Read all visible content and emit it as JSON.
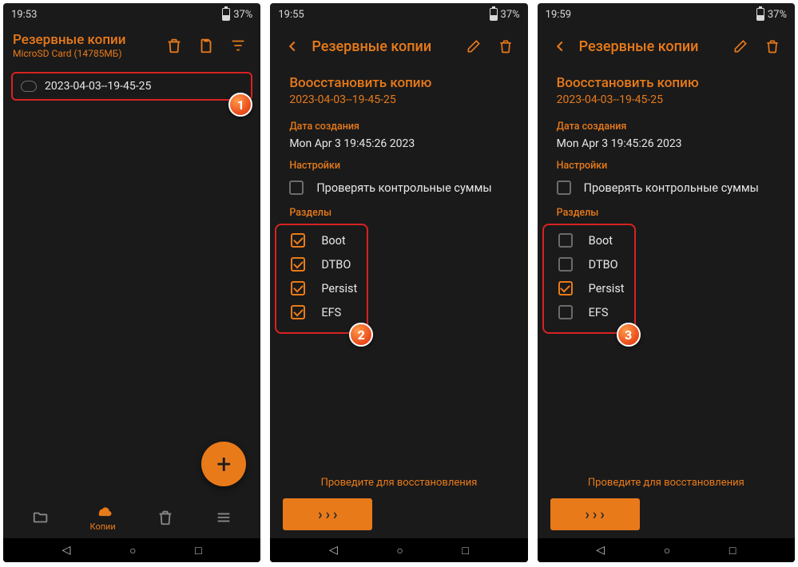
{
  "screens": [
    {
      "status": {
        "time": "19:53",
        "battery": "37%"
      },
      "header": {
        "title": "Резервные копии",
        "subtitle": "MicroSD Card (14785МБ)"
      },
      "backup_row": "2023-04-03--19-45-25",
      "nav": {
        "label": "Копии"
      },
      "badge": "1"
    },
    {
      "status": {
        "time": "19:55",
        "battery": "37%"
      },
      "header": {
        "title": "Резервные копии"
      },
      "restore": {
        "title": "Воосстановить копию",
        "sub": "2023-04-03--19-45-25"
      },
      "section_date": "Дата создания",
      "date_val": "Mon Apr  3 19:45:26 2023",
      "section_settings": "Настройки",
      "settings_chk": "Проверять контрольные суммы",
      "section_parts": "Разделы",
      "parts": [
        {
          "label": "Boot",
          "checked": true
        },
        {
          "label": "DTBO",
          "checked": true
        },
        {
          "label": "Persist",
          "checked": true
        },
        {
          "label": "EFS",
          "checked": true
        }
      ],
      "swipe": "Проведите для восстановления",
      "badge": "2"
    },
    {
      "status": {
        "time": "19:59",
        "battery": "37%"
      },
      "header": {
        "title": "Резервные копии"
      },
      "restore": {
        "title": "Воосстановить копию",
        "sub": "2023-04-03--19-45-25"
      },
      "section_date": "Дата создания",
      "date_val": "Mon Apr  3 19:45:26 2023",
      "section_settings": "Настройки",
      "settings_chk": "Проверять контрольные суммы",
      "section_parts": "Разделы",
      "parts": [
        {
          "label": "Boot",
          "checked": false
        },
        {
          "label": "DTBO",
          "checked": false
        },
        {
          "label": "Persist",
          "checked": true
        },
        {
          "label": "EFS",
          "checked": false
        }
      ],
      "swipe": "Проведите для восстановления",
      "badge": "3"
    }
  ]
}
